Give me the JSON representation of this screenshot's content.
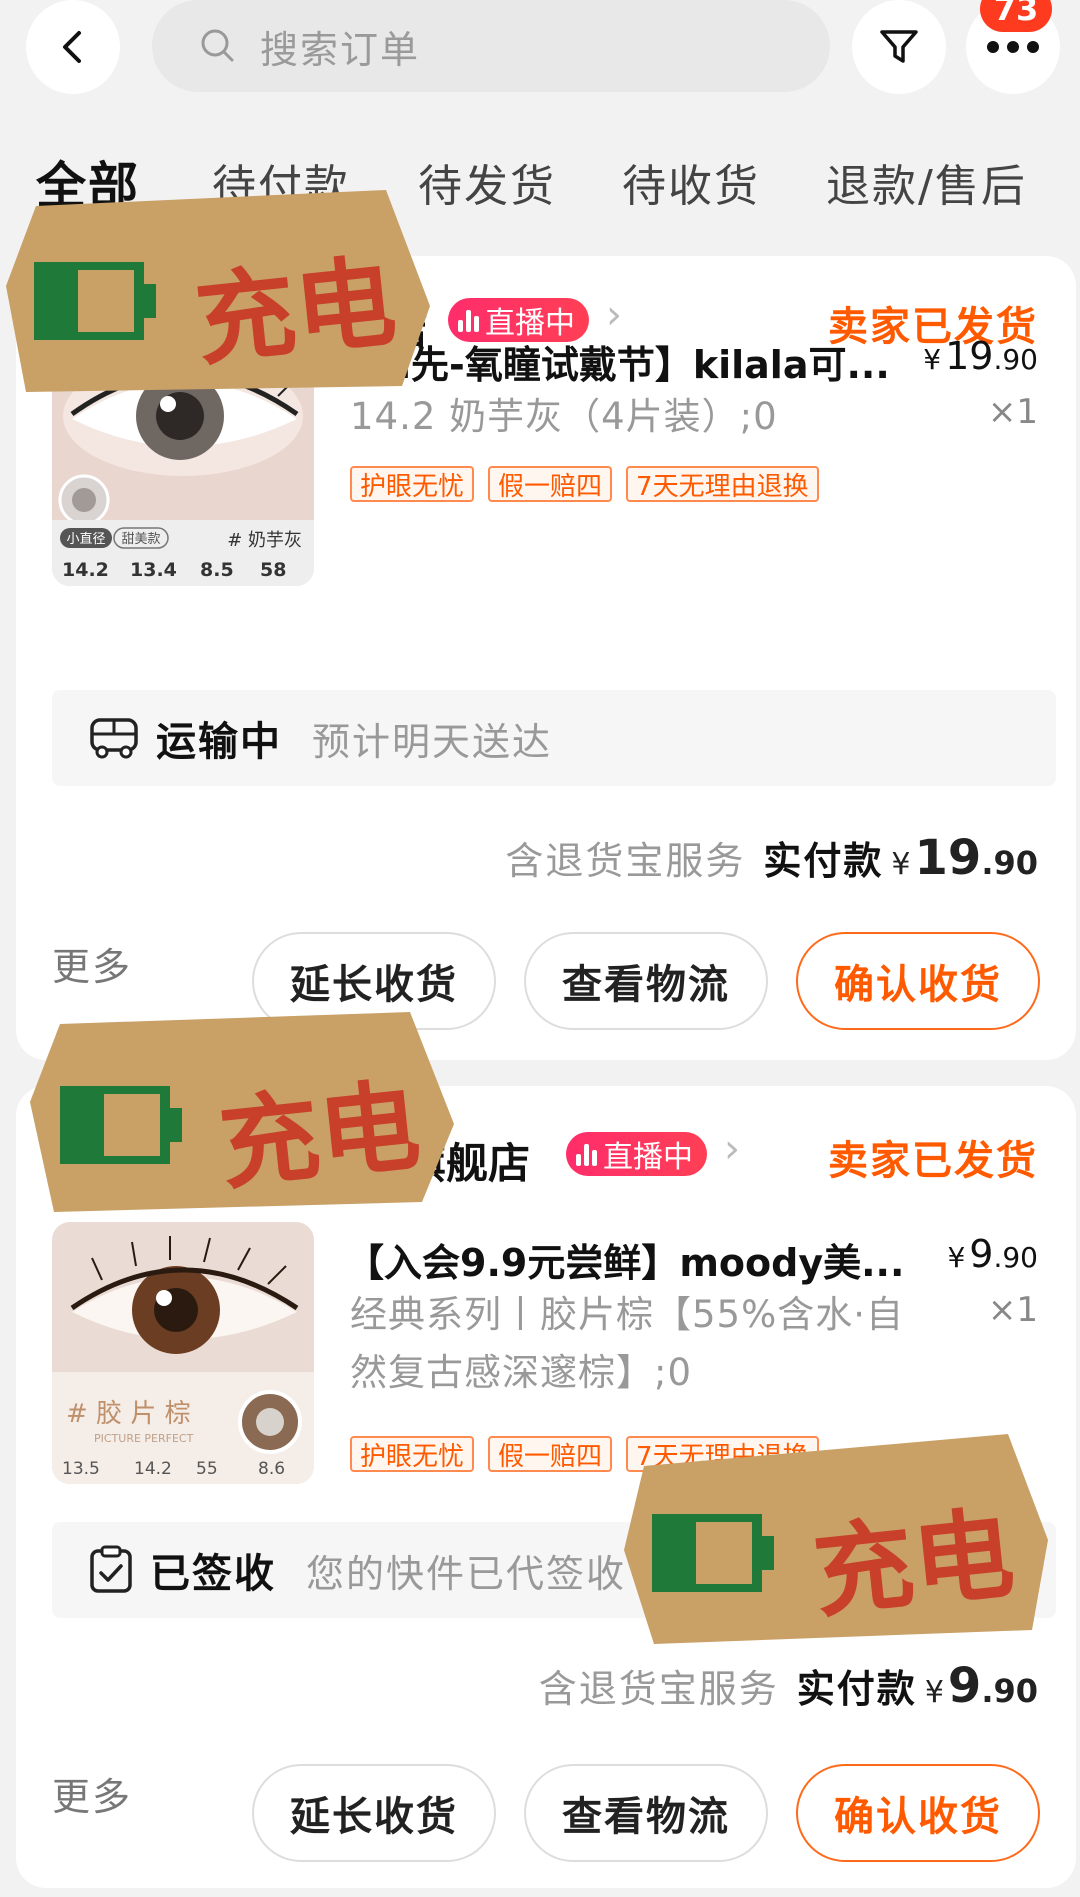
{
  "topbar": {
    "search_placeholder": "搜索订单",
    "more_badge": "73"
  },
  "tabs": [
    "全部",
    "待付款",
    "待发货",
    "待收货",
    "退款/售后"
  ],
  "orders": [
    {
      "shop_name": "店",
      "live_label": "直播中",
      "status": "卖家已发货",
      "title": "【u先-氧瞳试戴节】kilala可...",
      "price": {
        "symbol": "¥",
        "int": "19",
        "dec": ".90"
      },
      "spec": "14.2 奶芋灰（4片装）;0",
      "qty": "×1",
      "tags": [
        "护眼无忧",
        "假一赔四",
        "7天无理由退换"
      ],
      "thumb": {
        "color_name": "# 奶芋灰",
        "chip1": "小直径",
        "chip2": "甜美款",
        "specs": [
          "14.2",
          "13.4",
          "8.5",
          "58"
        ]
      },
      "shipping": {
        "label": "运输中",
        "desc": "预计明天送达"
      },
      "service": "含退货宝服务",
      "paid_label": "实付款",
      "paid": {
        "symbol": "¥",
        "int": "19",
        "dec": ".90"
      },
      "more": "更多",
      "buttons": [
        "延长收货",
        "查看物流",
        "确认收货"
      ]
    },
    {
      "shop_name": "旗舰店",
      "live_label": "直播中",
      "status": "卖家已发货",
      "title": "【入会9.9元尝鲜】moody美...",
      "price": {
        "symbol": "¥",
        "int": "9",
        "dec": ".90"
      },
      "spec": "经典系列丨胶片棕【55%含水·自然复古感深邃棕】;0",
      "qty": "×1",
      "tags": [
        "护眼无忧",
        "假一赔四",
        "7天无理由退换"
      ],
      "thumb": {
        "color_name": "# 胶 片 棕",
        "sub": "PICTURE PERFECT",
        "specs": [
          "13.5",
          "14.2",
          "55",
          "8.6"
        ]
      },
      "shipping": {
        "label": "已签收",
        "desc": "您的快件已代签收"
      },
      "service": "含退货宝服务",
      "paid_label": "实付款",
      "paid": {
        "symbol": "¥",
        "int": "9",
        "dec": ".90"
      },
      "more": "更多",
      "buttons": [
        "延长收货",
        "查看物流",
        "确认收货"
      ]
    }
  ],
  "sticker_text": "充电",
  "colors": {
    "accent": "#ff5a00",
    "live": "#ff2d6b",
    "sticker_bg": "#c9a066",
    "sticker_text": "#c8402a",
    "battery": "#1f7a3a"
  }
}
